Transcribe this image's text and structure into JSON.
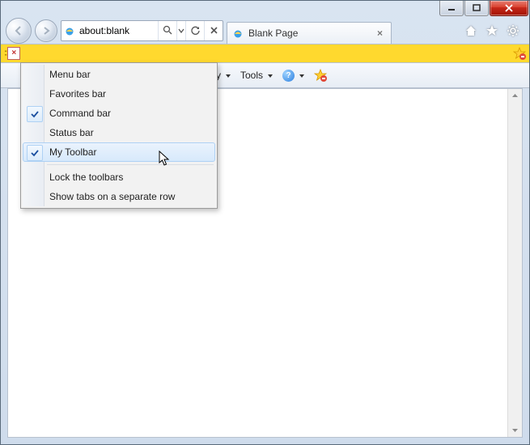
{
  "address": {
    "value": "about:blank"
  },
  "tab": {
    "title": "Blank Page"
  },
  "commandbar": {
    "partial_item": "y",
    "tools_label": "Tools",
    "help_symbol": "?"
  },
  "context_menu": {
    "items": [
      {
        "label": "Menu bar",
        "checked": false
      },
      {
        "label": "Favorites bar",
        "checked": false
      },
      {
        "label": "Command bar",
        "checked": true
      },
      {
        "label": "Status bar",
        "checked": false
      },
      {
        "label": "My Toolbar",
        "checked": true,
        "hover": true
      }
    ],
    "items2": [
      {
        "label": "Lock the toolbars"
      },
      {
        "label": "Show tabs on a separate row"
      }
    ]
  }
}
